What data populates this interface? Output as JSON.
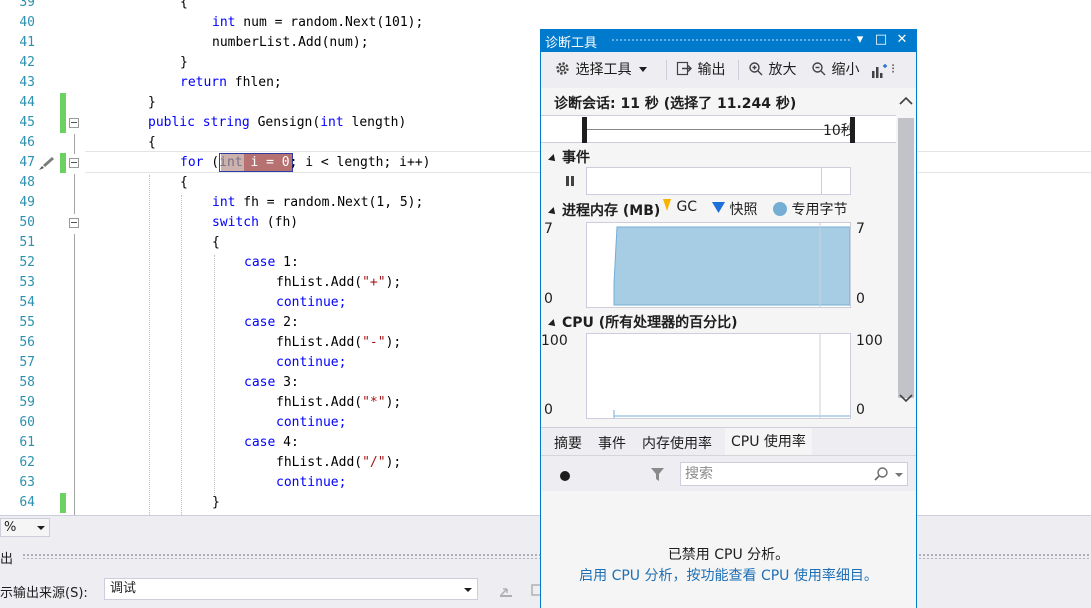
{
  "editor": {
    "lines": [
      {
        "num": "39"
      },
      {
        "num": "40"
      },
      {
        "num": "41"
      },
      {
        "num": "42"
      },
      {
        "num": "43"
      },
      {
        "num": "44"
      },
      {
        "num": "45"
      },
      {
        "num": "46"
      },
      {
        "num": "47"
      },
      {
        "num": "48"
      },
      {
        "num": "49"
      },
      {
        "num": "50"
      },
      {
        "num": "51"
      },
      {
        "num": "52"
      },
      {
        "num": "53"
      },
      {
        "num": "54"
      },
      {
        "num": "55"
      },
      {
        "num": "56"
      },
      {
        "num": "57"
      },
      {
        "num": "58"
      },
      {
        "num": "59"
      },
      {
        "num": "60"
      },
      {
        "num": "61"
      },
      {
        "num": "62"
      },
      {
        "num": "63"
      },
      {
        "num": "64"
      }
    ],
    "code": {
      "l39": "{",
      "l40a": "int",
      "l40b": " num = random.Next(101);",
      "l41": "numberList.Add(num);",
      "l42": "}",
      "l43a": "return",
      "l43b": " fhlen;",
      "l44": "}",
      "l45a": "public",
      "l45b": " ",
      "l45c": "string",
      "l45d": " Gensign(",
      "l45e": "int",
      "l45f": " length)",
      "l46": "{",
      "l47a": "for",
      "l47b": " (",
      "l47c": "int",
      "l47d": " i = 0",
      "l47e": "; i < length; i++)",
      "l48": "{",
      "l49a": "int",
      "l49b": " fh = random.Next(1, 5);",
      "l50a": "switch",
      "l50b": " (fh)",
      "l51": "{",
      "l52a": "case",
      "l52b": " 1:",
      "l53a": "fhList.Add(",
      "l53b": "\"+\"",
      "l53c": ");",
      "l54": "continue;",
      "l55a": "case",
      "l55b": " 2:",
      "l56a": "fhList.Add(",
      "l56b": "\"-\"",
      "l56c": ");",
      "l57": "continue;",
      "l58a": "case",
      "l58b": " 3:",
      "l59a": "fhList.Add(",
      "l59b": "\"*\"",
      "l59c": ");",
      "l60": "continue;",
      "l61a": "case",
      "l61b": " 4:",
      "l62a": "fhList.Add(",
      "l62b": "\"/\"",
      "l62c": ");",
      "l63": "continue;",
      "l64": "}"
    }
  },
  "zoom": {
    "value": "%"
  },
  "output": {
    "title": "出",
    "source_label": "示输出来源(S):",
    "source_value": "调试"
  },
  "diagnostics": {
    "title": "诊断工具",
    "title_buttons": {
      "menu": "▾",
      "maximize": "□",
      "close": "✕"
    },
    "toolbar": {
      "select_tools": "选择工具",
      "output": "输出",
      "zoom_in": "放大",
      "zoom_out": "缩小"
    },
    "session": "诊断会话: 11 秒 (选择了 11.244 秒)",
    "timeline_label": "10秒",
    "events_title": "事件",
    "memory": {
      "title": "进程内存 (MB)",
      "legend": [
        "GC",
        "快照",
        "专用字节"
      ],
      "colors": {
        "gc": "#f6b300",
        "snapshot": "#1e6fd9",
        "private": "#74aed4"
      },
      "y_max_label": "7",
      "y_min_label": "0",
      "y_max": 7,
      "y_min": 0,
      "value": 7
    },
    "cpu": {
      "title": "CPU (所有处理器的百分比)",
      "y_max_label": "100",
      "y_min_label": "0"
    },
    "tabs": [
      "摘要",
      "事件",
      "内存使用率",
      "CPU 使用率"
    ],
    "search_placeholder": "搜索",
    "disabled_msg": "已禁用 CPU 分析。",
    "enable_link": "启用 CPU 分析，按功能查看 CPU 使用率细目。"
  }
}
